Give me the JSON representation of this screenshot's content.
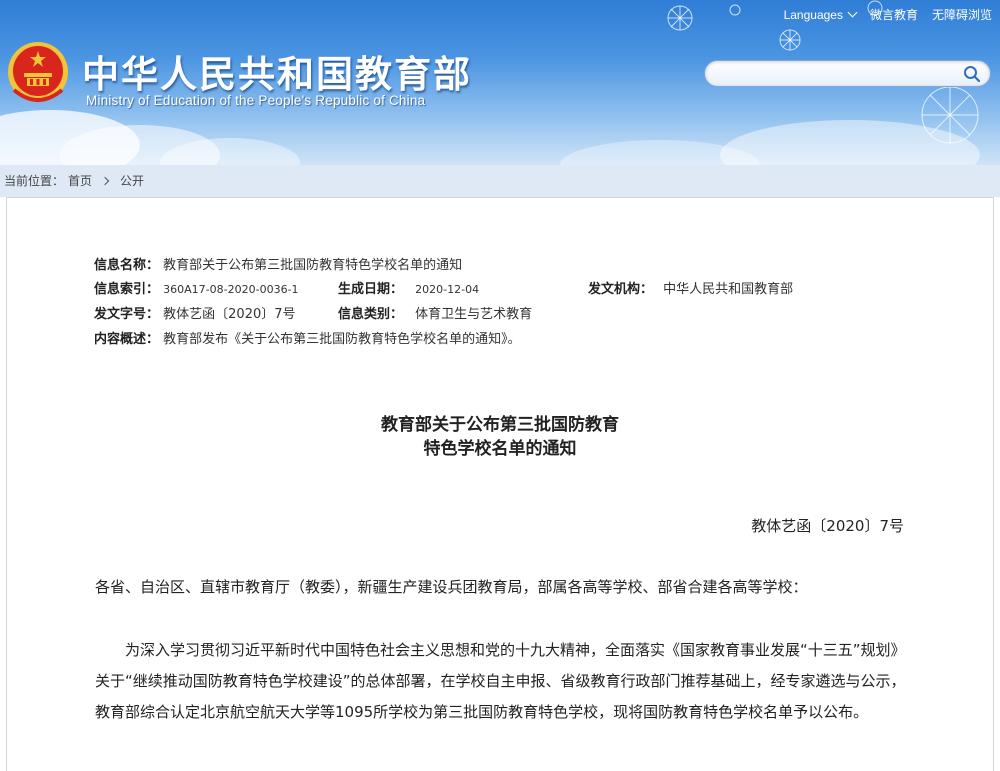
{
  "header": {
    "site_title": "中华人民共和国教育部",
    "site_subtitle": "Ministry of Education of the People's Republic of China",
    "toplinks": {
      "languages": "Languages",
      "weiyan": "微言教育",
      "accessibility": "无障碍浏览"
    },
    "search": {
      "placeholder": "",
      "value": ""
    }
  },
  "breadcrumb": {
    "prefix": "当前位置：",
    "home": "首页",
    "current": "公开"
  },
  "meta": {
    "name_label": "信息名称：",
    "name_value": "教育部关于公布第三批国防教育特色学校名单的通知",
    "index_label": "信息索引：",
    "index_value": "360A17-08-2020-0036-1",
    "date_label": "生成日期：",
    "date_value": "2020-12-04",
    "org_label": "发文机构：",
    "org_value": "中华人民共和国教育部",
    "docno_label": "发文字号：",
    "docno_value": "教体艺函〔2020〕7号",
    "category_label": "信息类别：",
    "category_value": "体育卫生与艺术教育",
    "summary_label": "内容概述：",
    "summary_value": "教育部发布《关于公布第三批国防教育特色学校名单的通知》。"
  },
  "document": {
    "title_line1": "教育部关于公布第三批国防教育",
    "title_line2": "特色学校名单的通知",
    "doc_number": "教体艺函〔2020〕7号",
    "salutation": "各省、自治区、直辖市教育厅（教委），新疆生产建设兵团教育局，部属各高等学校、部省合建各高等学校：",
    "para1": "为深入学习贯彻习近平新时代中国特色社会主义思想和党的十九大精神，全面落实《国家教育事业发展“十三五”规划》关于“继续推动国防教育特色学校建设”的总体部署，在学校自主申报、省级教育行政部门推荐基础上，经专家遴选与公示，教育部综合认定北京航空航天大学等1095所学校为第三批国防教育特色学校，现将国防教育特色学校名单予以公布。"
  },
  "colors": {
    "header_top": "#2f7dd6",
    "emblem_red": "#d8261c",
    "emblem_gold": "#f3c33a",
    "breadcrumb_bg": "#dfe9f5"
  },
  "icons": {
    "emblem": "national-emblem-icon",
    "search": "search-icon",
    "languages": "chevron-down-icon"
  }
}
